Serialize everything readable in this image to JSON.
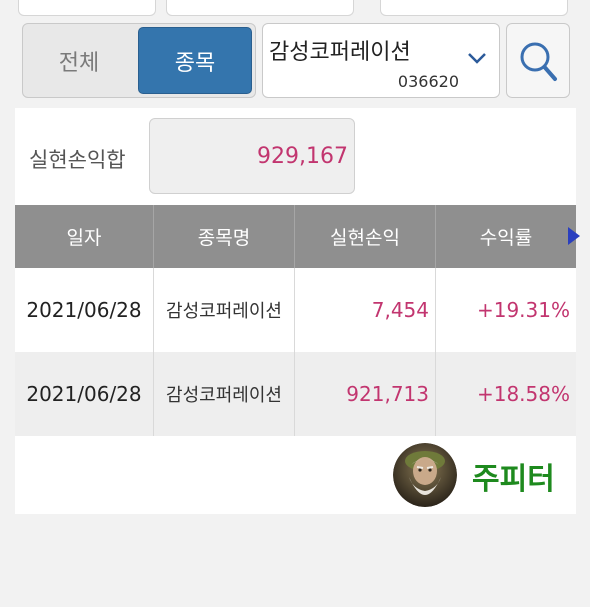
{
  "filter_tabs": [
    {
      "label": "전체",
      "active": false
    },
    {
      "label": "종목",
      "active": true
    }
  ],
  "stock": {
    "name": "감성코퍼레이션",
    "code": "036620"
  },
  "summary": {
    "label": "실현손익합",
    "value": "929,167"
  },
  "table": {
    "headers": [
      "일자",
      "종목명",
      "실현손익",
      "수익률"
    ],
    "rows": [
      {
        "date": "2021/06/28",
        "name": "감성코퍼레이션",
        "profit": "7,454",
        "rate": "+19.31%"
      },
      {
        "date": "2021/06/28",
        "name": "감성코퍼레이션",
        "profit": "921,713",
        "rate": "+18.58%"
      }
    ]
  },
  "watermark": {
    "text": "주피터"
  },
  "colors": {
    "accent": "#3475ad",
    "profit": "#c2356f",
    "brand": "#1e8a1e",
    "header": "#8f8f8f"
  },
  "icons": {
    "search": "search-icon",
    "dropdown": "chevron-down-icon",
    "scroll_right": "triangle-right-icon",
    "avatar": "zeus-avatar"
  }
}
